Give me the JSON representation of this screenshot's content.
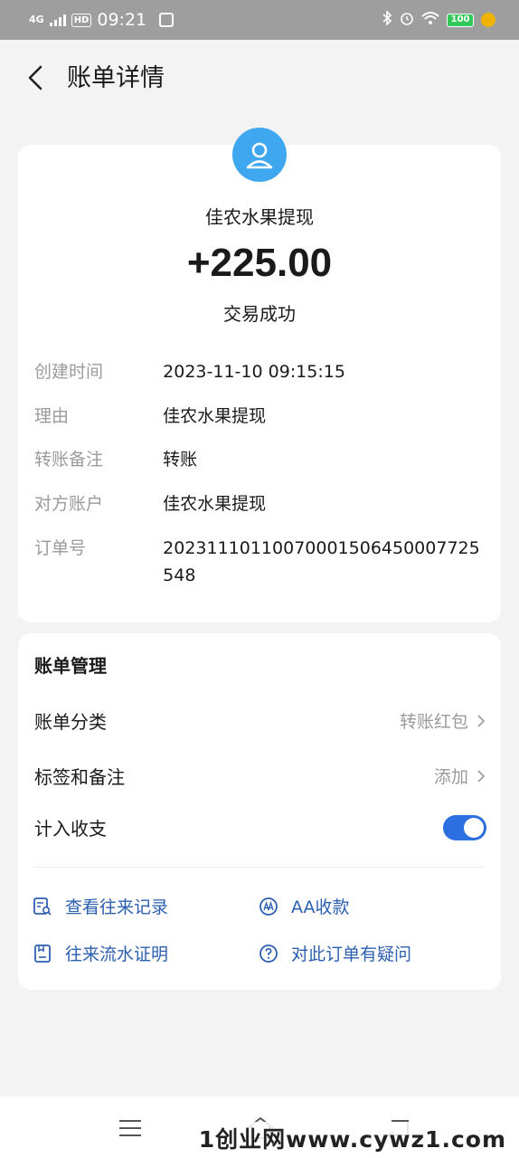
{
  "status_bar": {
    "network": "4G",
    "hd": "HD",
    "time": "09:21",
    "app_icon": "pay-icon",
    "battery": "100"
  },
  "header": {
    "title": "账单详情"
  },
  "transaction": {
    "name": "佳农水果提现",
    "amount": "+225.00",
    "status": "交易成功",
    "avatar_color": "#3fa6f0"
  },
  "details": [
    {
      "label": "创建时间",
      "value": "2023-11-10 09:15:15"
    },
    {
      "label": "理由",
      "value": "佳农水果提现"
    },
    {
      "label": "转账备注",
      "value": "转账"
    },
    {
      "label": "对方账户",
      "value": "佳农水果提现"
    },
    {
      "label": "订单号",
      "value": "20231110110070001506450007725548"
    }
  ],
  "management": {
    "title": "账单管理",
    "category_label": "账单分类",
    "category_value": "转账红包",
    "tags_label": "标签和备注",
    "tags_value": "添加",
    "income_label": "计入收支",
    "income_enabled": true
  },
  "links": {
    "history": "查看往来记录",
    "aa": "AA收款",
    "statement": "往来流水证明",
    "question": "对此订单有疑问"
  },
  "watermark": "1创业网www.cywz1.com",
  "colors": {
    "accent": "#2b6fe0",
    "link": "#2c5fb0",
    "label_gray": "#9a9a9a"
  }
}
